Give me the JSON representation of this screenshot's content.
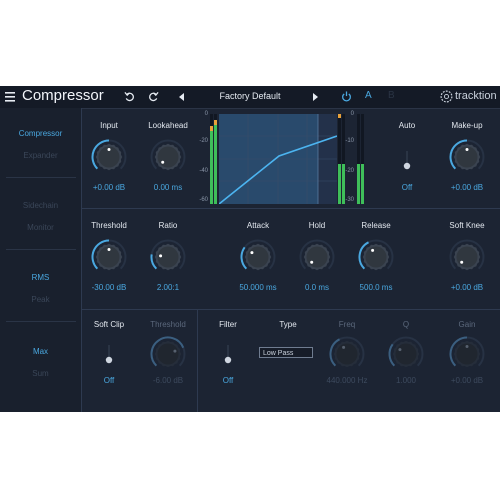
{
  "header": {
    "menu_icon": "hamburger-menu-icon",
    "title": "Compressor",
    "undo_icon": "undo-icon",
    "redo_icon": "redo-icon",
    "prev_preset_icon": "caret-left-icon",
    "preset_name": "Factory Default",
    "next_preset_icon": "caret-right-icon",
    "power_icon": "power-icon",
    "ab_a": "A",
    "ab_b": "B",
    "brand": "tracktion"
  },
  "sidebar": {
    "items": [
      {
        "label": "Compressor",
        "active": true
      },
      {
        "label": "Expander",
        "active": false
      },
      {
        "label": "Sidechain",
        "active": false
      },
      {
        "label": "Monitor",
        "active": false
      },
      {
        "label": "RMS",
        "active": true
      },
      {
        "label": "Peak",
        "active": false
      },
      {
        "label": "Max",
        "active": true
      },
      {
        "label": "Sum",
        "active": false
      }
    ]
  },
  "top_section": {
    "input": {
      "label": "Input",
      "value": "+0.00 dB",
      "level": 0.5
    },
    "lookahead": {
      "label": "Lookahead",
      "value": "0.00 ms",
      "level": 0.0
    },
    "meter_left_scale": [
      "0",
      "-20",
      "-40",
      "-60"
    ],
    "meter_right_scale": [
      "0",
      "-10",
      "-20",
      "-30"
    ],
    "auto": {
      "label": "Auto",
      "value": "Off"
    },
    "makeup": {
      "label": "Make-up",
      "value": "+0.00 dB",
      "level": 0.5
    }
  },
  "middle_section": {
    "threshold": {
      "label": "Threshold",
      "value": "-30.00 dB",
      "level": 0.5
    },
    "ratio": {
      "label": "Ratio",
      "value": "2.00:1",
      "level": 0.2
    },
    "attack": {
      "label": "Attack",
      "value": "50.000 ms",
      "level": 0.3
    },
    "hold": {
      "label": "Hold",
      "value": "0.0 ms",
      "level": 0.0
    },
    "release": {
      "label": "Release",
      "value": "500.0 ms",
      "level": 0.4
    },
    "soft_knee": {
      "label": "Soft Knee",
      "value": "+0.00 dB",
      "level": 0.0
    }
  },
  "bottom_section": {
    "soft_clip": {
      "label": "Soft Clip",
      "value": "Off"
    },
    "clip_threshold": {
      "label": "Threshold",
      "value": "-6.00 dB",
      "level": 0.75
    },
    "filter": {
      "label": "Filter",
      "value": "Off"
    },
    "type": {
      "label": "Type",
      "value": "Low Pass"
    },
    "freq": {
      "label": "Freq",
      "value": "440.000 Hz",
      "level": 0.4
    },
    "q": {
      "label": "Q",
      "value": "1.000",
      "level": 0.3
    },
    "gain": {
      "label": "Gain",
      "value": "+0.00 dB",
      "level": 0.5
    }
  },
  "colors": {
    "panel": "#1c2433",
    "accent": "#4aa8e0",
    "text": "#e3e8ef",
    "meter_green": "#3fbf5a",
    "meter_orange": "#e8a13a"
  }
}
